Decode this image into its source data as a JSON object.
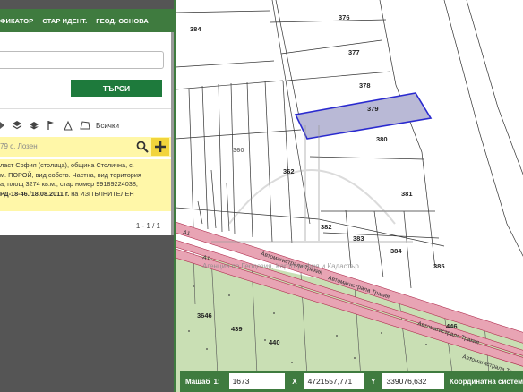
{
  "top_nav": {
    "items": [
      "ФИКАТОР",
      "СТАР ИДЕНТ.",
      "ГЕОД. ОСНОВА"
    ]
  },
  "search": {
    "input_value": "",
    "button_label": "ТЪРСИ"
  },
  "layers": {
    "all_label": "Всички"
  },
  "result": {
    "title": "79 с. Лозен",
    "desc_lines": [
      "ласт София (столица), община Столична, с.",
      "м. ПОРОЙ, вид собств. Частна, вид територия",
      "а, площ 3274 кв.м., стар номер 99189224038,"
    ],
    "desc_bold": "РД-18-46./18.08.2011 г.",
    "desc_tail": " на ИЗПЪЛНИТЕЛЕН",
    "pager": "1 - 1 / 1"
  },
  "map": {
    "parcels": [
      "384",
      "376",
      "377",
      "378",
      "379",
      "380",
      "381",
      "360",
      "362",
      "382",
      "383",
      "384",
      "385",
      "3646",
      "439",
      "440",
      "446"
    ],
    "roads": [
      "А1",
      "Автомагистрала Тракия",
      "Автомагистрала Тракия",
      "Автомагистрала Тракия",
      "Автомагистрала Тракия"
    ],
    "watermark": "Агенция по Геодезия, Картография и Кадастър",
    "highlight_color": "#2a2acf",
    "highlight_fill": "#b9b9d6"
  },
  "status": {
    "scale_label": "Мащаб",
    "scale_prefix": "1:",
    "scale_value": "1673",
    "x_label": "X",
    "x_value": "4721557,771",
    "y_label": "Y",
    "y_value": "339076,632",
    "crs_label": "Координатна систем"
  }
}
